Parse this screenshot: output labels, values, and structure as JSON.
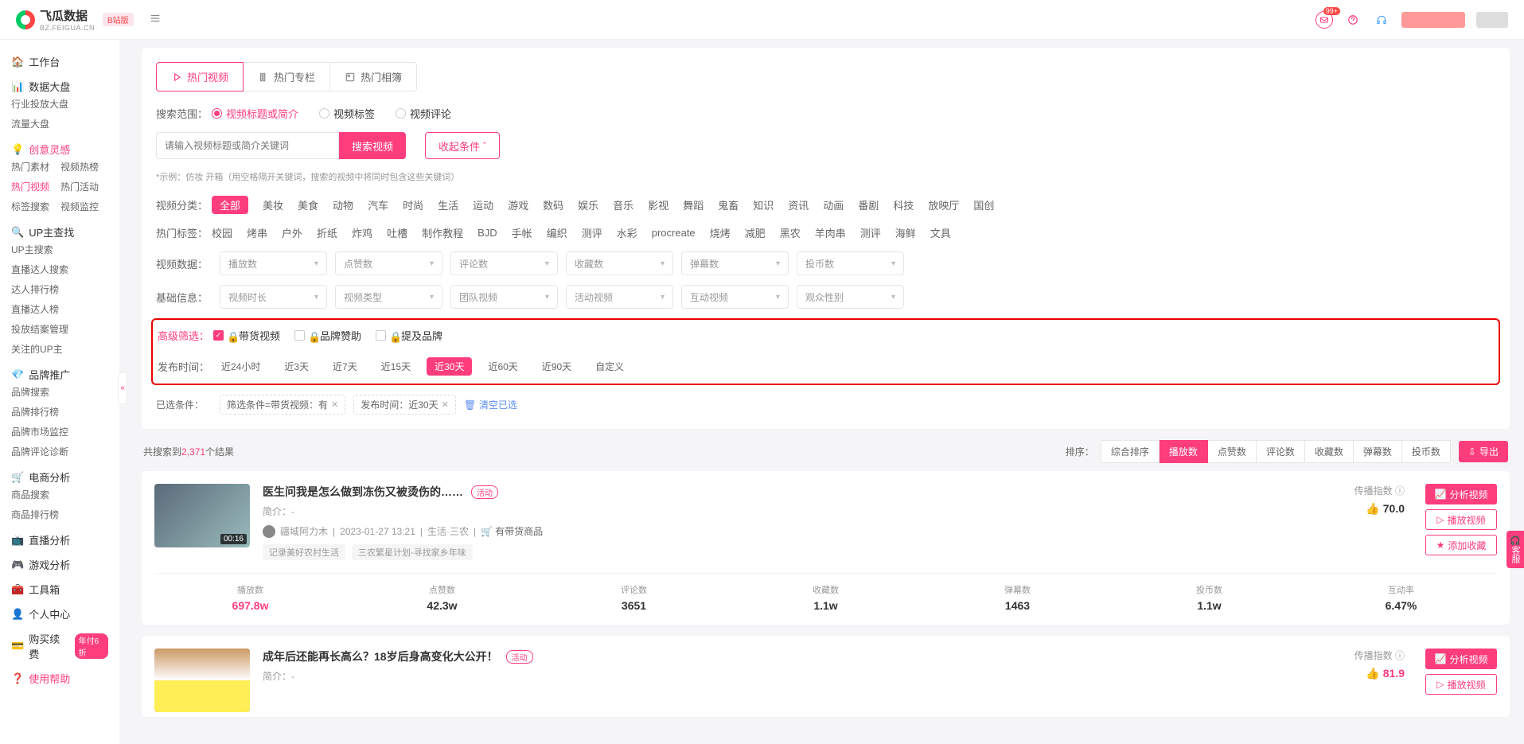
{
  "brand": {
    "name": "飞瓜数据",
    "sub": "BZ.FEIGUA.CN",
    "badge": "B站版"
  },
  "topbar": {
    "notif_badge": "99+"
  },
  "sidebar": {
    "workbench": "工作台",
    "dashboard": "数据大盘",
    "dashboard_sub": [
      "行业投放大盘",
      "流量大盘"
    ],
    "creative": "创意灵感",
    "creative_sub": [
      "热门素材",
      "视频热榜",
      "热门视频",
      "热门活动",
      "标签搜索",
      "视频监控"
    ],
    "up_search": "UP主查找",
    "up_sub": [
      "UP主搜索",
      "直播达人搜索",
      "达人排行榜",
      "直播达人榜",
      "投放结案管理",
      "关注的UP主"
    ],
    "brand": "品牌推广",
    "brand_sub": [
      "品牌搜索",
      "品牌排行榜",
      "品牌市场监控",
      "品牌评论诊断"
    ],
    "ecom": "电商分析",
    "ecom_sub": [
      "商品搜索",
      "商品排行榜"
    ],
    "live": "直播分析",
    "game": "游戏分析",
    "tools": "工具箱",
    "personal": "个人中心",
    "renew": "购买续费",
    "renew_badge": "年付6折",
    "help": "使用帮助"
  },
  "tabs": [
    "热门视频",
    "热门专栏",
    "热门相簿"
  ],
  "search": {
    "scope_label": "搜索范围：",
    "scopes": [
      "视频标题或简介",
      "视频标签",
      "视频评论"
    ],
    "placeholder": "请输入视频标题或简介关键词",
    "btn": "搜索视频",
    "collapse": "收起条件",
    "hint": "*示例：仿妆 开箱（用空格隔开关键词，搜索的视频中将同时包含这些关键词）"
  },
  "cat": {
    "label": "视频分类：",
    "all": "全部",
    "items": [
      "美妆",
      "美食",
      "动物",
      "汽车",
      "时尚",
      "生活",
      "运动",
      "游戏",
      "数码",
      "娱乐",
      "音乐",
      "影视",
      "舞蹈",
      "鬼畜",
      "知识",
      "资讯",
      "动画",
      "番剧",
      "科技",
      "放映厅",
      "国创"
    ]
  },
  "hot_tags": {
    "label": "热门标签：",
    "items": [
      "校园",
      "烤串",
      "户外",
      "折纸",
      "炸鸡",
      "吐槽",
      "制作教程",
      "BJD",
      "手帐",
      "编织",
      "测评",
      "水彩",
      "procreate",
      "烧烤",
      "减肥",
      "黑农",
      "羊肉串",
      "测评",
      "海鲜",
      "文具"
    ]
  },
  "data_label": "视频数据：",
  "data_selects": [
    "播放数",
    "点赞数",
    "评论数",
    "收藏数",
    "弹幕数",
    "投币数"
  ],
  "info_label": "基础信息：",
  "info_selects": [
    "视频时长",
    "视频类型",
    "团队视频",
    "活动视频",
    "互动视频",
    "观众性别"
  ],
  "adv": {
    "label": "高级筛选：",
    "opts": [
      "带货视频",
      "品牌赞助",
      "提及品牌"
    ]
  },
  "pub": {
    "label": "发布时间：",
    "items": [
      "近24小时",
      "近3天",
      "近7天",
      "近15天",
      "近30天",
      "近60天",
      "近90天",
      "自定义"
    ]
  },
  "chips": {
    "label": "已选条件：",
    "chip1": "筛选条件=带货视频：有",
    "chip2": "发布时间：近30天",
    "clear": "清空已选"
  },
  "results": {
    "count_prefix": "共搜索到",
    "count": "2,371",
    "count_suffix": "个结果",
    "sort_label": "排序：",
    "sort_opts": [
      "综合排序",
      "播放数",
      "点赞数",
      "评论数",
      "收藏数",
      "弹幕数",
      "投币数"
    ],
    "export": "导出"
  },
  "video1": {
    "title": "医生问我是怎么做到冻伤又被烫伤的……",
    "activity": "活动",
    "intro_label": "简介：",
    "intro": "-",
    "author": "疆域阿力木",
    "date": "2023-01-27 13:21",
    "zone": "生活·三农",
    "goods": "有带货商品",
    "tags": [
      "记录美好农村生活",
      "三农繁星计划-寻找家乡年味"
    ],
    "duration": "00:16",
    "spread_label": "传播指数",
    "score": "70.0",
    "btn1": "分析视频",
    "btn2": "播放视频",
    "btn3": "添加收藏",
    "stats": [
      {
        "k": "播放数",
        "v": "697.8w",
        "pink": true
      },
      {
        "k": "点赞数",
        "v": "42.3w"
      },
      {
        "k": "评论数",
        "v": "3651"
      },
      {
        "k": "收藏数",
        "v": "1.1w"
      },
      {
        "k": "弹幕数",
        "v": "1463"
      },
      {
        "k": "投币数",
        "v": "1.1w"
      },
      {
        "k": "互动率",
        "v": "6.47%"
      }
    ]
  },
  "video2": {
    "title": "成年后还能再长高么？18岁后身高变化大公开！",
    "activity": "活动",
    "intro_label": "简介：",
    "intro": "-",
    "spread_label": "传播指数",
    "score": "81.9",
    "btn1": "分析视频",
    "btn2": "播放视频"
  },
  "floater": "客服"
}
